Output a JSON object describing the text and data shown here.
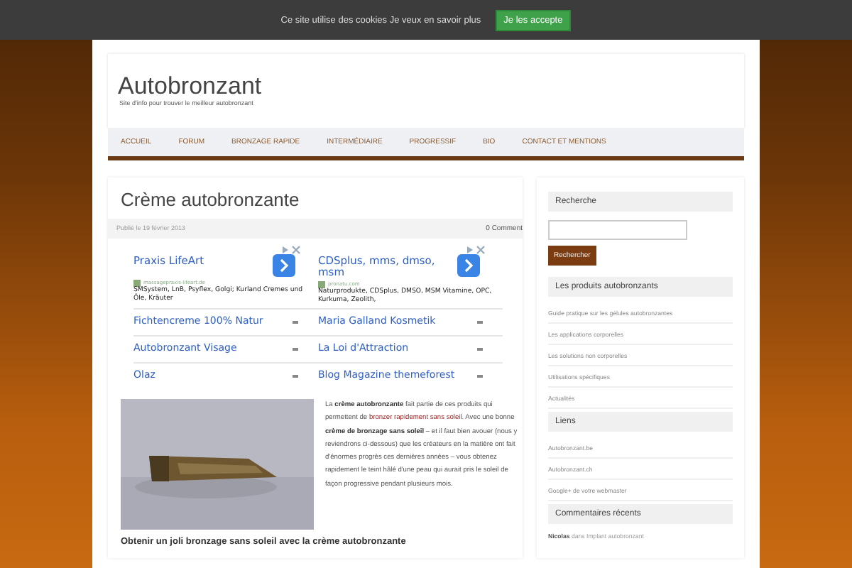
{
  "cookie_bar": {
    "text": "Ce site utilise des cookies Je veux en savoir plus",
    "button": "Je les accepte"
  },
  "header": {
    "title": "Autobronzant",
    "tagline": "Site d'info pour trouver le meilleur autobronzant"
  },
  "nav": [
    {
      "label": "ACCUEIL"
    },
    {
      "label": "FORUM"
    },
    {
      "label": "BRONZAGE RAPIDE"
    },
    {
      "label": "INTERMÉDIAIRE"
    },
    {
      "label": "PROGRESSIF"
    },
    {
      "label": "BIO"
    },
    {
      "label": "CONTACT ET MENTIONS"
    }
  ],
  "post": {
    "title": "Crème autobronzante",
    "date": "Publié le 19 février 2013",
    "comments": "0 Comment",
    "ads": [
      {
        "title": "Praxis LifeArt",
        "domain": "massagepraxis-lifeart.de",
        "text": "SMSystem, LnB, Psyflex, Golgi; Kurland Cremes und Öle, Kräuter"
      },
      {
        "title": "CDSplus, mms, dmso, msm",
        "domain": "pronatu.com",
        "text": "Naturprodukte, CDSplus, DMSO, MSM Vitamine, OPC, Kurkuma, Zeolith,"
      }
    ],
    "ad_links": [
      "Fichtencreme 100% Natur",
      "Maria Galland Kosmetik",
      "Autobronzant Visage",
      "La Loi d'Attraction",
      "Olaz",
      "Blog Magazine themeforest"
    ],
    "image": {
      "kind": "picture"
    },
    "paragraph": [
      {
        "kind": "plain",
        "text": "La "
      },
      {
        "kind": "bold",
        "text": "crème autobronzante"
      },
      {
        "kind": "plain",
        "text": " fait partie de ces produits qui permettent de "
      },
      {
        "kind": "link",
        "text": "bronzer rapidement sans soleil."
      },
      {
        "kind": "plain",
        "text": " Avec une bonne "
      },
      {
        "kind": "bold",
        "text": "crème de bronzage sans soleil"
      },
      {
        "kind": "plain",
        "text": " – et il faut bien avouer (nous y reviendrons ci-dessous) que les créateurs en la matière ont fait d'énormes progrès ces dernières années – vous obtenez rapidement le teint hâlé d'une peau qui aurait pris le soleil de façon progressive pendant plusieurs mois."
      }
    ],
    "subheading": "Obtenir un joli bronzage sans soleil avec la crème autobronzante"
  },
  "sidebar": {
    "search_title": "Recherche",
    "search_button": "Rechercher",
    "widgets": [
      {
        "title": "Les produits autobronzants",
        "items": [
          "Guide pratique sur les gélules autobronzantes",
          "Les applications corporelles",
          "Les solutions non corporelles",
          "Utilisations spécifiques",
          "Actualités"
        ]
      },
      {
        "title": "Liens",
        "items": [
          "Autobronzant.be",
          "Autobronzant.ch",
          "Google+ de votre webmaster"
        ]
      },
      {
        "title": "Commentaires récents"
      }
    ],
    "recent_comment": {
      "author": "Nicolas",
      "connector": "dans",
      "post": "Implant autobronzant"
    }
  }
}
